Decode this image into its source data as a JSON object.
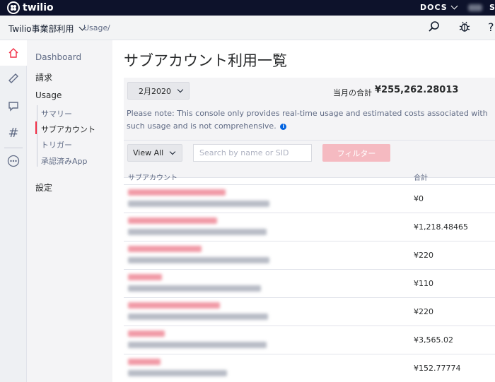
{
  "topbar": {
    "logo_text": "twilio",
    "docs_label": "DOCS",
    "trailing_letter": "S"
  },
  "subbar": {
    "account_name": "Twilio事業部利用",
    "breadcrumb": "Usage",
    "breadcrumb_sep": "/",
    "help_label": "?"
  },
  "rail": {
    "hash_label": "#"
  },
  "nav": {
    "dashboard": "Dashboard",
    "billing": "請求",
    "usage": "Usage",
    "sub_items": [
      "サマリー",
      "サブアカウント",
      "トリガー",
      "承認済みApp"
    ],
    "settings": "設定"
  },
  "main": {
    "title": "サブアカウント利用一覧",
    "month": "2月2020",
    "total_label": "当月の合計",
    "total_value": "¥255,262.28013",
    "note": "Please note: This console only provides real-time usage and estimated costs associated with such usage and is not comprehensive.",
    "info_glyph": "i",
    "view_all": "View All",
    "search_placeholder": "Search by name or SID",
    "filter_button": "フィルター"
  },
  "table": {
    "col_account": "サブアカウント",
    "col_total": "合計",
    "rows": [
      {
        "amount": "¥0"
      },
      {
        "amount": "¥1,218.48465"
      },
      {
        "amount": "¥220"
      },
      {
        "amount": "¥110"
      },
      {
        "amount": "¥220"
      },
      {
        "amount": "¥3,565.02"
      },
      {
        "amount": "¥152.77774"
      }
    ]
  },
  "colors": {
    "topbar": "#0d122b",
    "accent_red": "#f22f46",
    "filter_button_disabled": "#f5bac1",
    "info_blue": "#0263e0"
  },
  "icons": {
    "topbar": [
      "twilio-logo-icon",
      "docs-chevron-down-icon"
    ],
    "subbar": [
      "account-chevron-down-icon",
      "search-icon",
      "bug-icon",
      "help-icon"
    ],
    "rail": [
      "home-icon",
      "phone-icon",
      "chat-icon",
      "hash-icon",
      "more-icon"
    ]
  }
}
